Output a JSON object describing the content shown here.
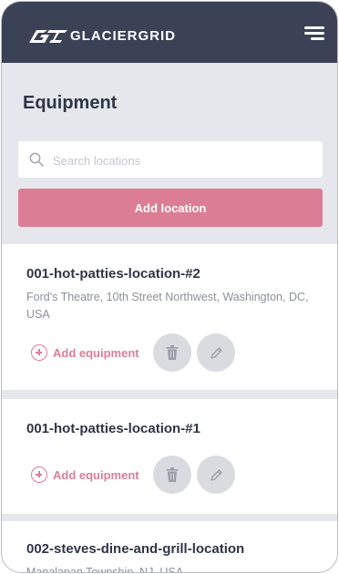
{
  "app": {
    "brand": "GLACIERGRID",
    "brand_color": "#3b4256",
    "accent_color": "#db7e95",
    "menu_icon": "hamburger-menu-icon"
  },
  "page": {
    "title": "Equipment"
  },
  "search": {
    "placeholder": "Search locations",
    "value": "",
    "icon": "search-icon"
  },
  "actions": {
    "add_location": "Add location"
  },
  "locations": [
    {
      "name": "001-hot-patties-location-#2",
      "address": "Ford's Theatre, 10th Street Northwest, Washington, DC, USA",
      "add_equipment": "Add equipment",
      "delete_icon": "trash-icon",
      "edit_icon": "pencil-icon"
    },
    {
      "name": "001-hot-patties-location-#1",
      "address": "",
      "add_equipment": "Add equipment",
      "delete_icon": "trash-icon",
      "edit_icon": "pencil-icon"
    },
    {
      "name": "002-steves-dine-and-grill-location",
      "address": "Manalapan Township, NJ, USA"
    }
  ]
}
